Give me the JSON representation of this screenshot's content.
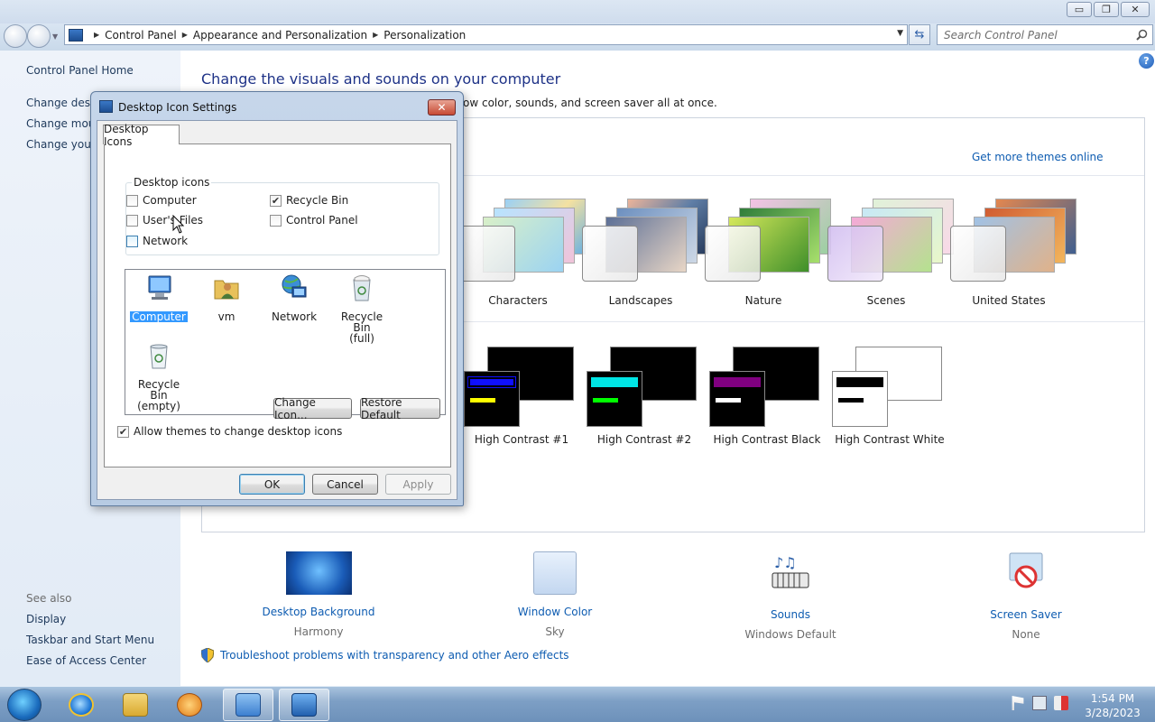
{
  "window": {
    "caption_buttons": {
      "minimize": "▭",
      "restore": "❐",
      "close": "✕"
    }
  },
  "address": {
    "crumbs": [
      "Control Panel",
      "Appearance and Personalization",
      "Personalization"
    ],
    "search_placeholder": "Search Control Panel"
  },
  "left_pane": {
    "home": "Control Panel Home",
    "links": [
      "Change desktop icons",
      "Change mouse pointers",
      "Change your account picture"
    ],
    "see_also_title": "See also",
    "see_also": [
      "Display",
      "Taskbar and Start Menu",
      "Ease of Access Center"
    ]
  },
  "main": {
    "title": "Change the visuals and sounds on your computer",
    "description": "ow color, sounds, and screen saver all at once.",
    "get_more": "Get more themes online",
    "themes": [
      "Characters",
      "Landscapes",
      "Nature",
      "Scenes",
      "United States"
    ],
    "hc_themes": [
      "High Contrast #1",
      "High Contrast #2",
      "High Contrast Black",
      "High Contrast White"
    ],
    "bottom": [
      {
        "label": "Desktop Background",
        "sub": "Harmony",
        "icon": "desktop-background-icon"
      },
      {
        "label": "Window Color",
        "sub": "Sky",
        "icon": "window-color-icon"
      },
      {
        "label": "Sounds",
        "sub": "Windows Default",
        "icon": "sounds-icon"
      },
      {
        "label": "Screen Saver",
        "sub": "None",
        "icon": "screen-saver-icon"
      }
    ],
    "troubleshoot": "Troubleshoot problems with transparency and other Aero effects"
  },
  "dialog": {
    "title": "Desktop Icon Settings",
    "tab": "Desktop Icons",
    "group_title": "Desktop icons",
    "checkboxes": [
      {
        "label": "Computer",
        "checked": false
      },
      {
        "label": "Recycle Bin",
        "checked": true
      },
      {
        "label": "User's Files",
        "checked": false
      },
      {
        "label": "Control Panel",
        "checked": false
      },
      {
        "label": "Network",
        "checked": false
      }
    ],
    "icons": [
      {
        "label": "Computer",
        "selected": true
      },
      {
        "label": "vm",
        "selected": false
      },
      {
        "label": "Network",
        "selected": false
      },
      {
        "label": "Recycle Bin",
        "label2": "(full)",
        "selected": false
      },
      {
        "label": "Recycle Bin",
        "label2": "(empty)",
        "selected": false
      }
    ],
    "change_icon": "Change Icon...",
    "restore_default": "Restore Default",
    "allow_themes": "Allow themes to change desktop icons",
    "allow_themes_checked": true,
    "ok": "OK",
    "cancel": "Cancel",
    "apply": "Apply"
  },
  "taskbar": {
    "time": "1:54 PM",
    "date": "3/28/2023"
  },
  "colors": {
    "link": "#0e5cb1",
    "title": "#1e3287",
    "selection": "#3399ff"
  }
}
